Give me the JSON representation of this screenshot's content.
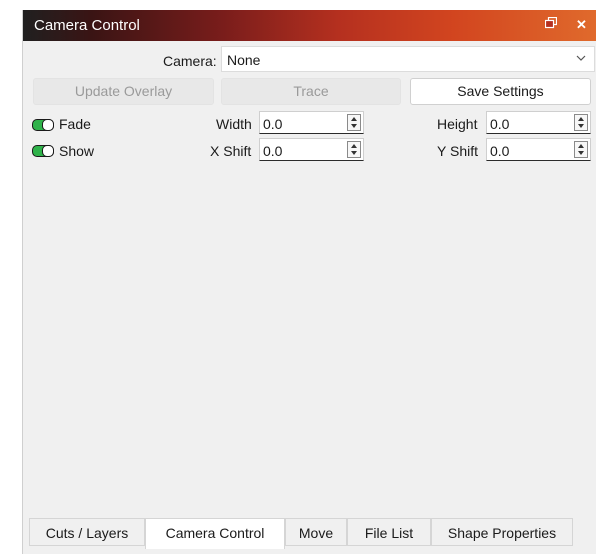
{
  "window": {
    "title": "Camera Control",
    "float_icon": "float-window-icon",
    "close_symbol": "✕",
    "close_icon": "close-icon"
  },
  "camera": {
    "label": "Camera:",
    "value": "None",
    "dropdown_icon": "chevron-down-icon"
  },
  "buttons": {
    "update_overlay": "Update Overlay",
    "trace": "Trace",
    "save_settings": "Save Settings"
  },
  "toggles": [
    {
      "label": "Fade",
      "on": true
    },
    {
      "label": "Show",
      "on": true
    }
  ],
  "fields": {
    "width": {
      "label": "Width",
      "value": "0.0"
    },
    "height": {
      "label": "Height",
      "value": "0.0"
    },
    "x_shift": {
      "label": "X Shift",
      "value": "0.0"
    },
    "y_shift": {
      "label": "Y Shift",
      "value": "0.0"
    }
  },
  "tabs": [
    {
      "label": "Cuts / Layers",
      "active": false
    },
    {
      "label": "Camera Control",
      "active": true
    },
    {
      "label": "Move",
      "active": false
    },
    {
      "label": "File List",
      "active": false
    },
    {
      "label": "Shape Properties",
      "active": false
    }
  ],
  "colors": {
    "title_gradient_start": "#202020",
    "title_gradient_end": "#e06a2c",
    "toggle_on": "#2fb24a",
    "panel_background": "#f0f0f0"
  }
}
